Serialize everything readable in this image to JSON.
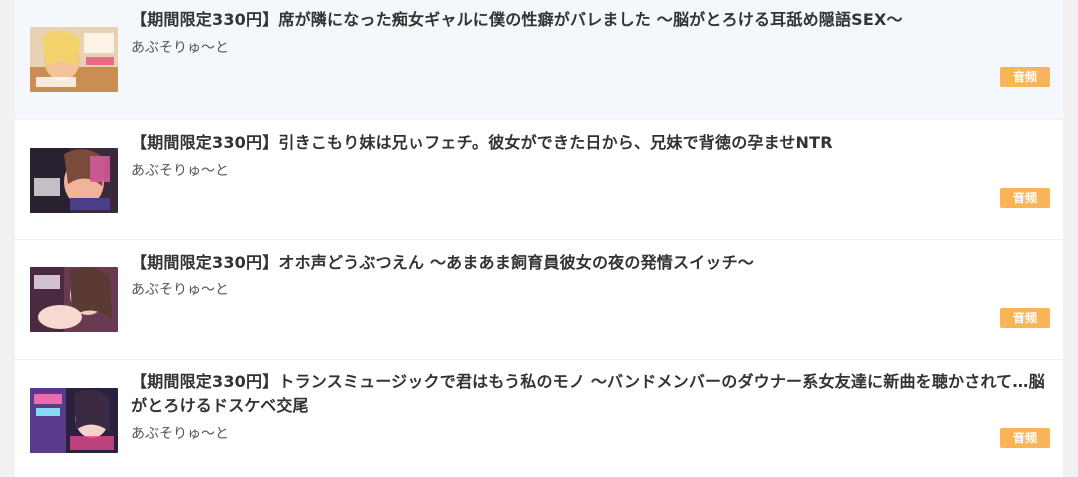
{
  "items": [
    {
      "title": "【期間限定330円】席が隣になった痴女ギャルに僕の性癖がバレました ～脳がとろける耳舐め隠語SEX～",
      "author": "あぶそりゅ～と",
      "badge": "音频",
      "thumbnail": "cover-image"
    },
    {
      "title": "【期間限定330円】引きこもり妹は兄ぃフェチ。彼女ができた日から、兄妹で背徳の孕ませNTR",
      "author": "あぶそりゅ～と",
      "badge": "音频",
      "thumbnail": "cover-image"
    },
    {
      "title": "【期間限定330円】オホ声どうぶつえん ～あまあま飼育員彼女の夜の発情スイッチ～",
      "author": "あぶそりゅ～と",
      "badge": "音频",
      "thumbnail": "cover-image"
    },
    {
      "title": "【期間限定330円】トランスミュージックで君はもう私のモノ ～バンドメンバーのダウナー系女友達に新曲を聴かされて…脳がとろけるドスケベ交尾",
      "author": "あぶそりゅ～と",
      "badge": "音频",
      "thumbnail": "cover-image"
    }
  ],
  "colors": {
    "badge": "#f9b358",
    "active_row": "#f4f8fd",
    "title": "#333333",
    "author": "#555555"
  }
}
